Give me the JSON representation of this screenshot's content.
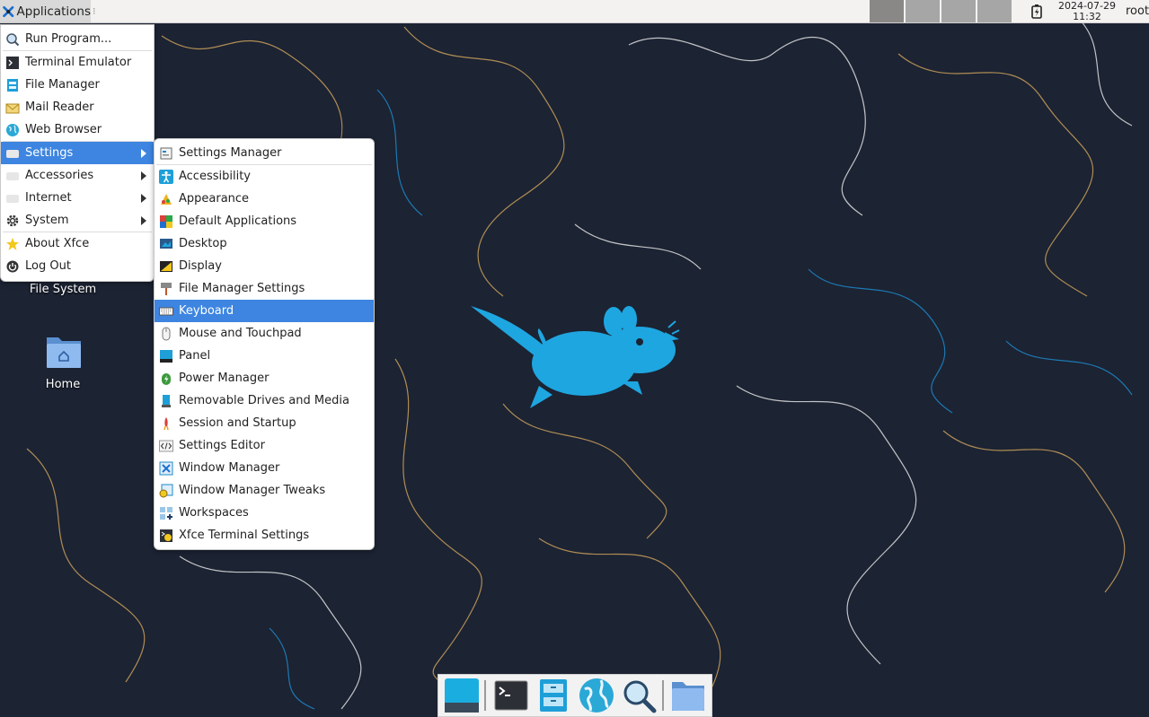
{
  "panel": {
    "applications_label": "Applications",
    "clock_date": "2024-07-29",
    "clock_time": "11:32",
    "user": "root",
    "workspace_count": 4
  },
  "main_menu": {
    "items": [
      {
        "label": "Run Program...",
        "icon": "run-program-icon"
      },
      {
        "label": "Terminal Emulator",
        "icon": "terminal-icon"
      },
      {
        "label": "File Manager",
        "icon": "file-manager-icon"
      },
      {
        "label": "Mail Reader",
        "icon": "mail-icon"
      },
      {
        "label": "Web Browser",
        "icon": "web-browser-icon"
      },
      {
        "label": "Settings",
        "icon": "settings-icon",
        "submenu": true,
        "active": true
      },
      {
        "label": "Accessories",
        "icon": "accessories-icon",
        "submenu": true
      },
      {
        "label": "Internet",
        "icon": "internet-icon",
        "submenu": true
      },
      {
        "label": "System",
        "icon": "gear-icon",
        "submenu": true
      },
      {
        "label": "About Xfce",
        "icon": "star-icon"
      },
      {
        "label": "Log Out",
        "icon": "logout-icon"
      }
    ]
  },
  "settings_menu": {
    "items": [
      {
        "label": "Settings Manager"
      },
      {
        "label": "Accessibility"
      },
      {
        "label": "Appearance"
      },
      {
        "label": "Default Applications"
      },
      {
        "label": "Desktop"
      },
      {
        "label": "Display"
      },
      {
        "label": "File Manager Settings"
      },
      {
        "label": "Keyboard",
        "active": true
      },
      {
        "label": "Mouse and Touchpad"
      },
      {
        "label": "Panel"
      },
      {
        "label": "Power Manager"
      },
      {
        "label": "Removable Drives and Media"
      },
      {
        "label": "Session and Startup"
      },
      {
        "label": "Settings Editor"
      },
      {
        "label": "Window Manager"
      },
      {
        "label": "Window Manager Tweaks"
      },
      {
        "label": "Workspaces"
      },
      {
        "label": "Xfce Terminal Settings"
      }
    ]
  },
  "desktop": {
    "file_system_label": "File System",
    "home_label": "Home"
  },
  "dock": {
    "items": [
      "show-desktop-icon",
      "terminal-icon",
      "file-manager-icon",
      "web-browser-icon",
      "search-icon",
      "folder-icon"
    ]
  },
  "colors": {
    "wallpaper": "#1c2333",
    "mouse": "#1ea6e0",
    "highlight": "#3d85e0"
  }
}
